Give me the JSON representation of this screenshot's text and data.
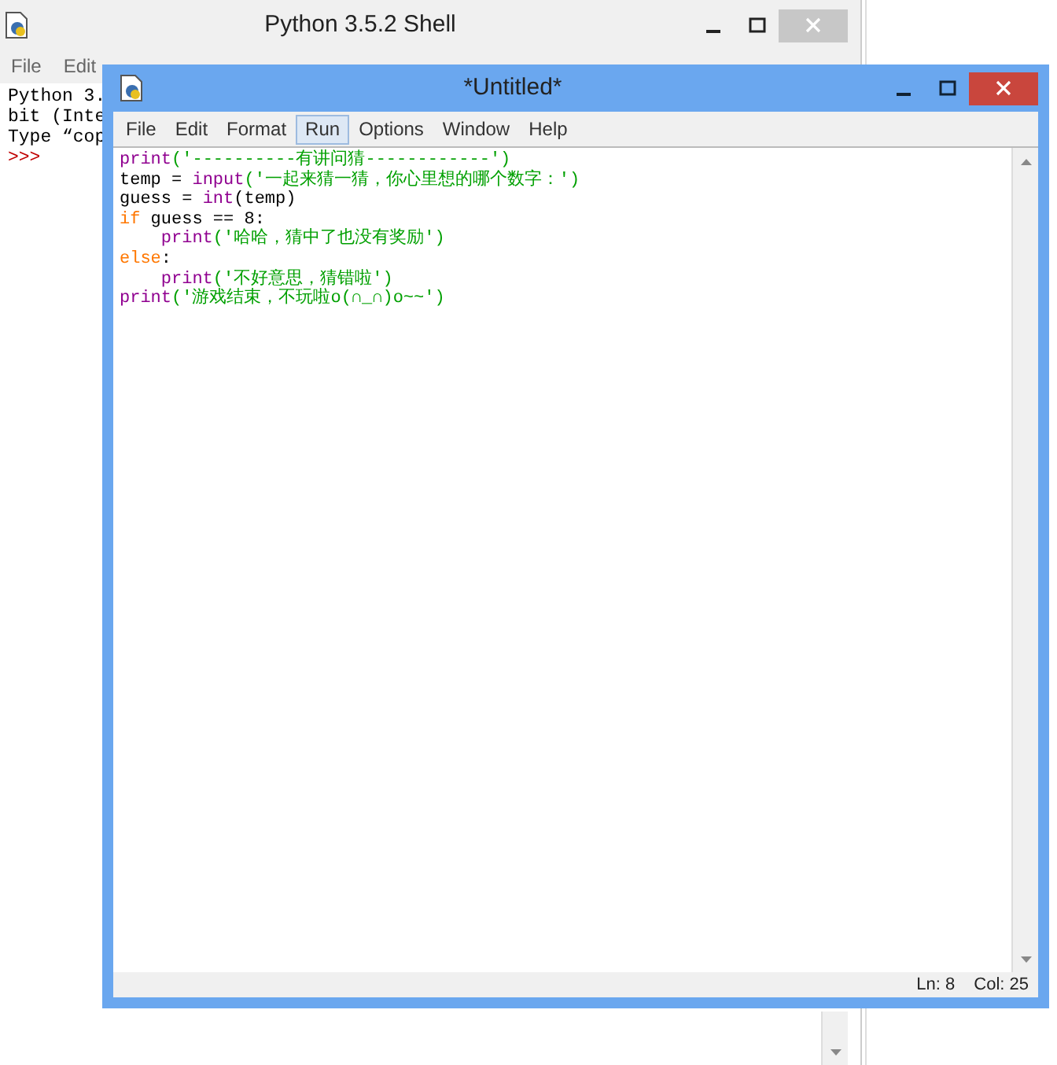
{
  "shell_window": {
    "title": "Python 3.5.2 Shell",
    "menu": [
      {
        "label": "File"
      },
      {
        "label": "Edit"
      }
    ],
    "output_lines": [
      {
        "text": "Python 3.",
        "kind": "plain"
      },
      {
        "text": "bit (Inte",
        "kind": "plain"
      },
      {
        "text": "Type “cop",
        "kind": "plain"
      },
      {
        "text": ">>>",
        "kind": "prompt"
      }
    ]
  },
  "editor_window": {
    "title": "*Untitled*",
    "menu": [
      {
        "label": "File",
        "selected": false
      },
      {
        "label": "Edit",
        "selected": false
      },
      {
        "label": "Format",
        "selected": false
      },
      {
        "label": "Run",
        "selected": true
      },
      {
        "label": "Options",
        "selected": false
      },
      {
        "label": "Window",
        "selected": false
      },
      {
        "label": "Help",
        "selected": false
      }
    ],
    "code_lines": [
      [
        {
          "text": "print",
          "kind": "builtin"
        },
        {
          "text": "('----------有讲问猜------------')",
          "kind": "string"
        }
      ],
      [
        {
          "text": "temp = ",
          "kind": "plain"
        },
        {
          "text": "input",
          "kind": "builtin"
        },
        {
          "text": "('一起来猜一猜，你心里想的哪个数字：')",
          "kind": "string"
        }
      ],
      [
        {
          "text": "guess = ",
          "kind": "plain"
        },
        {
          "text": "int",
          "kind": "builtin"
        },
        {
          "text": "(temp)",
          "kind": "plain"
        }
      ],
      [
        {
          "text": "if",
          "kind": "keyword"
        },
        {
          "text": " guess == 8:",
          "kind": "plain"
        }
      ],
      [
        {
          "text": "    print",
          "kind": "builtin"
        },
        {
          "text": "('哈哈，猜中了也没有奖励')",
          "kind": "string"
        }
      ],
      [
        {
          "text": "else",
          "kind": "keyword"
        },
        {
          "text": ":",
          "kind": "plain"
        }
      ],
      [
        {
          "text": "    print",
          "kind": "builtin"
        },
        {
          "text": "('不好意思，猜错啦')",
          "kind": "string"
        }
      ],
      [
        {
          "text": "print",
          "kind": "builtin"
        },
        {
          "text": "('游戏结束，不玩啦o(∩_∩)o~~')",
          "kind": "string"
        }
      ]
    ],
    "status_bar": {
      "line": "Ln: 8",
      "column": "Col: 25"
    }
  }
}
